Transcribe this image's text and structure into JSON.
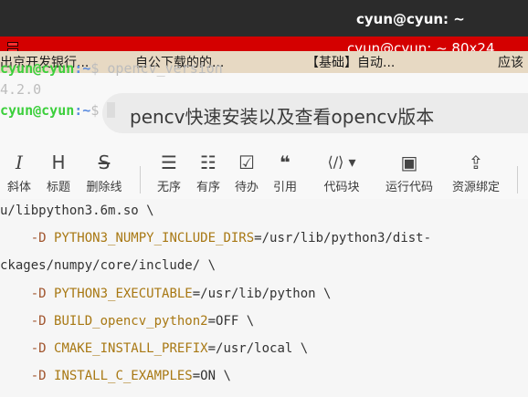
{
  "window": {
    "title": "cyun@cyun: ~",
    "tab_title": "cyun@cyun: ~ 80x24"
  },
  "ghost_tabs": [
    "出京开发银行...",
    "自公下载的的...",
    "【基础】自动...",
    "应该"
  ],
  "document": {
    "search_text": "pencv快速安装以及查看opencv版本"
  },
  "toolbar": [
    {
      "icon": "I",
      "label": "斜体",
      "name": "italic"
    },
    {
      "icon": "H",
      "label": "标题",
      "name": "heading"
    },
    {
      "icon": "S",
      "label": "删除线",
      "name": "strikethrough"
    },
    {
      "icon": "☰",
      "label": "无序",
      "name": "unordered-list"
    },
    {
      "icon": "☷",
      "label": "有序",
      "name": "ordered-list"
    },
    {
      "icon": "☑",
      "label": "待办",
      "name": "todo"
    },
    {
      "icon": "❝",
      "label": "引用",
      "name": "quote"
    },
    {
      "icon": "⟨/⟩ ▾",
      "label": "代码块",
      "name": "code-block"
    },
    {
      "icon": "▣",
      "label": "运行代码",
      "name": "run-code"
    },
    {
      "icon": "⇪",
      "label": "资源绑定",
      "name": "resource-binding"
    }
  ],
  "code_lines": [
    {
      "flag": "",
      "key": "",
      "rest": "u/libpython3.6m.so \\"
    },
    {
      "flag": "    -D ",
      "key": "PYTHON3_NUMPY_INCLUDE_DIRS",
      "rest": "=/usr/lib/python3/dist-"
    },
    {
      "flag": "",
      "key": "",
      "rest": "ckages/numpy/core/include/ \\"
    },
    {
      "flag": "    -D ",
      "key": "PYTHON3_EXECUTABLE",
      "rest": "=/usr/lib/python \\"
    },
    {
      "flag": "    -D ",
      "key": "BUILD_opencv_python2",
      "rest": "=OFF \\"
    },
    {
      "flag": "    -D ",
      "key": "CMAKE_INSTALL_PREFIX",
      "rest": "=/usr/local \\"
    },
    {
      "flag": "    -D ",
      "key": "INSTALL_C_EXAMPLES",
      "rest": "=ON \\"
    }
  ],
  "terminal": {
    "line1": {
      "user": "cyun@cyun",
      "path": ":~",
      "cmd": "$ opencv_version"
    },
    "line2": "4.2.0",
    "line3": {
      "user": "cyun@cyun",
      "path": ":~",
      "cmd": "$ "
    }
  }
}
